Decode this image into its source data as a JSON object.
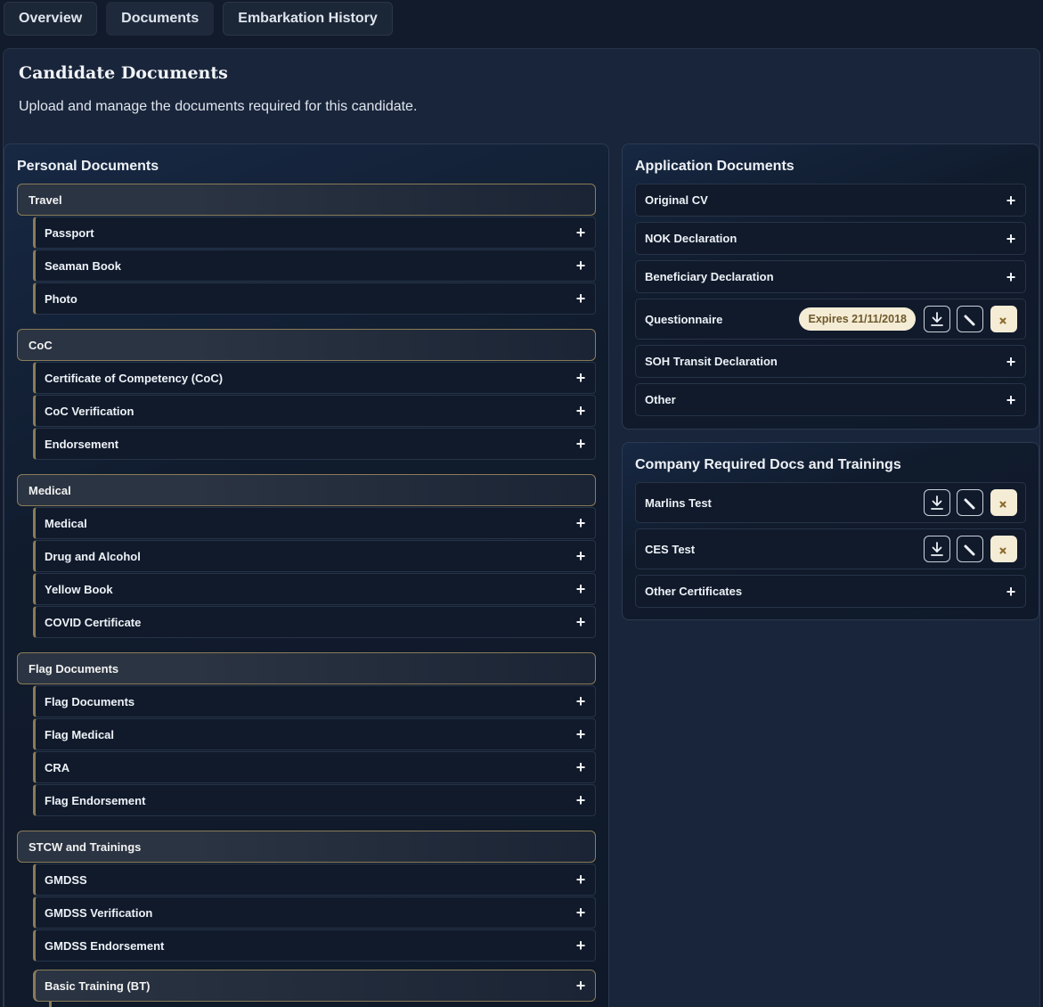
{
  "tabs": [
    {
      "label": "Overview"
    },
    {
      "label": "Documents"
    },
    {
      "label": "Embarkation History"
    }
  ],
  "panel": {
    "title": "Candidate Documents",
    "description": "Upload and manage the documents required for this candidate."
  },
  "personal": {
    "title": "Personal Documents",
    "groups": [
      {
        "label": "Travel",
        "items": [
          "Passport",
          "Seaman Book",
          "Photo"
        ]
      },
      {
        "label": "CoC",
        "items": [
          "Certificate of Competency (CoC)",
          "CoC Verification",
          "Endorsement"
        ]
      },
      {
        "label": "Medical",
        "items": [
          "Medical",
          "Drug and Alcohol",
          "Yellow Book",
          "COVID Certificate"
        ]
      },
      {
        "label": "Flag Documents",
        "items": [
          "Flag Documents",
          "Flag Medical",
          "CRA",
          "Flag Endorsement"
        ]
      },
      {
        "label": "STCW and Trainings",
        "items": [
          "GMDSS",
          "GMDSS Verification",
          "GMDSS Endorsement"
        ],
        "subgroup": "Basic Training (BT)"
      }
    ]
  },
  "application": {
    "title": "Application Documents",
    "items": [
      "Original CV",
      "NOK Declaration",
      "Beneficiary Declaration",
      "Questionnaire",
      "SOH Transit Declaration",
      "Other"
    ],
    "questionnaire_badge": "Expires 21/11/2018"
  },
  "company": {
    "title": "Company Required Docs and Trainings",
    "items": [
      "Marlins Test",
      "CES Test",
      "Other Certificates"
    ]
  },
  "icons": {
    "add": "plus-icon",
    "download": "download-icon",
    "edit": "edit-icon",
    "remove": "close-icon"
  },
  "colors": {
    "accent_gold": "#8a7c58",
    "badge_bg": "#f5ecd6",
    "badge_text": "#6e5a2c",
    "page_bg": "#111b2b"
  }
}
